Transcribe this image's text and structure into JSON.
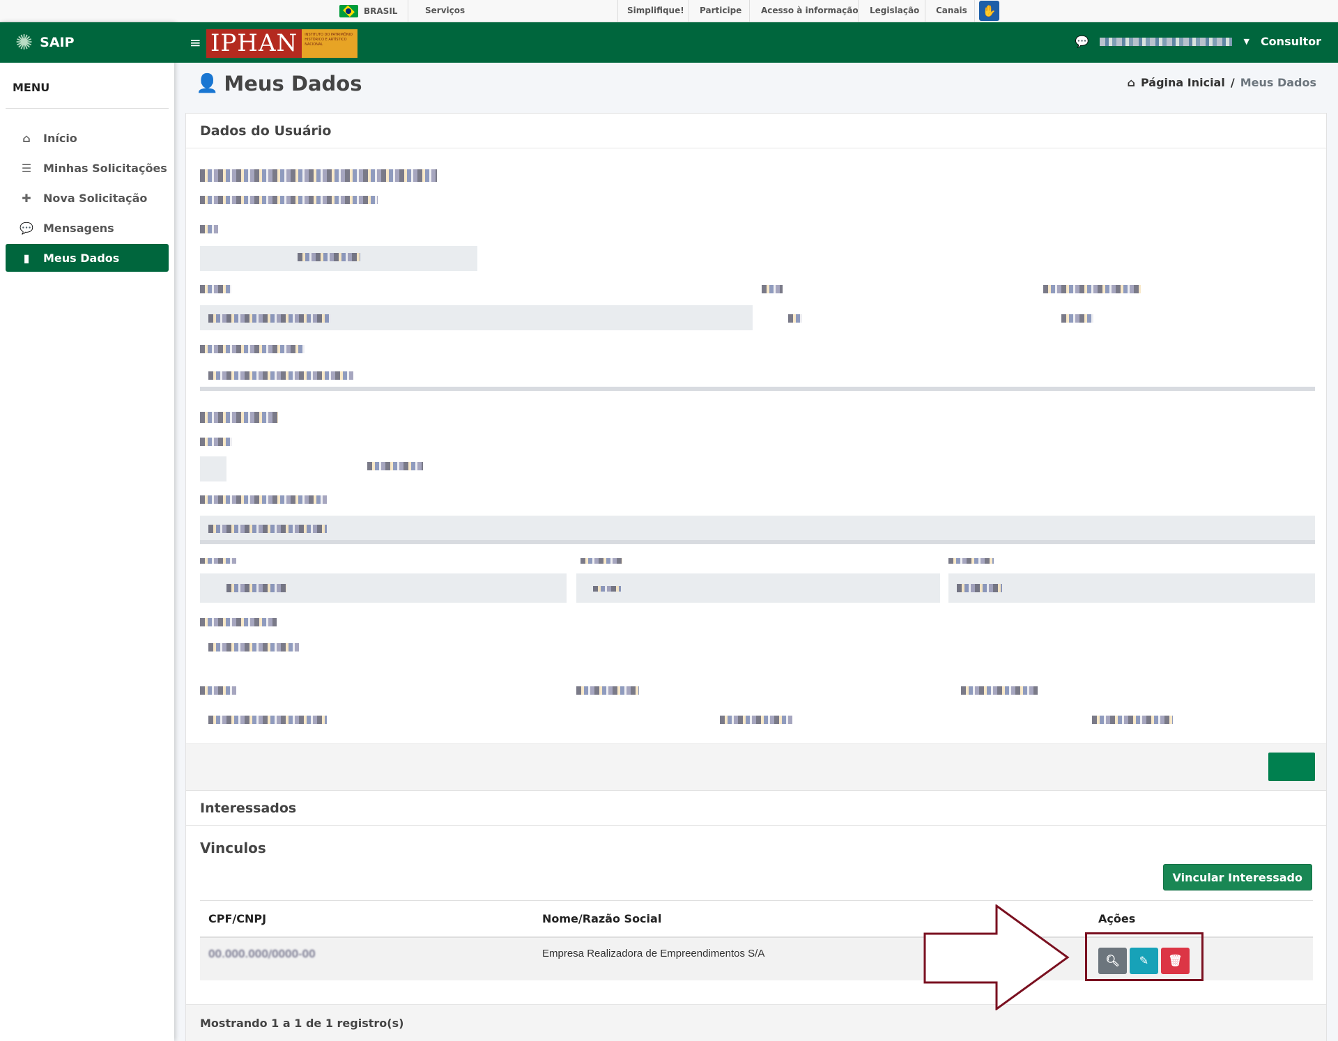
{
  "govbar": {
    "country": "BRASIL",
    "links": [
      "Serviços",
      "Simplifique!",
      "Participe",
      "Acesso à informação",
      "Legislação",
      "Canais"
    ]
  },
  "sidebar": {
    "brand": "SAIP",
    "menu_title": "MENU",
    "items": [
      {
        "label": "Início",
        "icon": "home-icon"
      },
      {
        "label": "Minhas Solicitações",
        "icon": "list-icon"
      },
      {
        "label": "Nova Solicitação",
        "icon": "plus-icon"
      },
      {
        "label": "Mensagens",
        "icon": "comments-icon"
      },
      {
        "label": "Meus Dados",
        "icon": "file-icon",
        "active": true
      }
    ]
  },
  "header": {
    "logo_text": "IPHAN",
    "logo_subtext": "INSTITUTO DO PATRIMÔNIO HISTÓRICO E ARTÍSTICO NACIONAL",
    "role": "Consultor"
  },
  "page": {
    "title": "Meus Dados",
    "breadcrumb_home": "Página Inicial",
    "breadcrumb_current": "Meus Dados"
  },
  "user_card": {
    "title": "Dados do Usuário"
  },
  "interessados": {
    "title": "Interessados",
    "subtitle": "Vinculos",
    "link_button": "Vincular Interessado",
    "columns": [
      "CPF/CNPJ",
      "Nome/Razão Social",
      "Ações"
    ],
    "rows": [
      {
        "cpf": "00.000.000/0000-00",
        "name": "Empresa Realizadora de Empreendimentos S/A"
      }
    ],
    "footer": "Mostrando 1 a 1 de 1 registro(s)"
  },
  "colors": {
    "primary_green": "#00663d",
    "view": "#6c757d",
    "edit": "#17a2b8",
    "delete": "#dc3545",
    "highlight": "#7a1020"
  }
}
